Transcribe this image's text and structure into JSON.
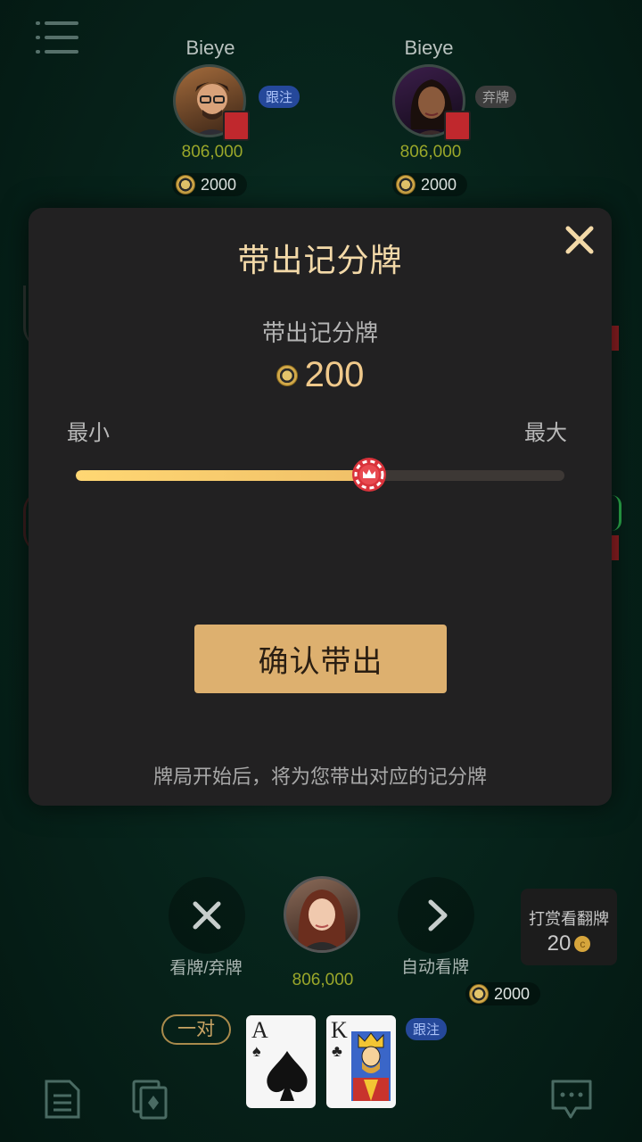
{
  "players": [
    {
      "name": "Bieye",
      "status": "跟注",
      "chips": "806,000",
      "bet": "2000"
    },
    {
      "name": "Bieye",
      "status": "弃牌",
      "chips": "806,000",
      "bet": "2000"
    }
  ],
  "modal": {
    "title": "带出记分牌",
    "subtitle": "带出记分牌",
    "amount": "200",
    "min_label": "最小",
    "max_label": "最大",
    "slider_value": 0.6,
    "confirm_label": "确认带出",
    "hint": "牌局开始后，将为您带出对应的记分牌"
  },
  "self": {
    "chips": "806,000",
    "bet": "2000",
    "hand_label": "一对",
    "status": "跟注",
    "cards": [
      {
        "rank": "A",
        "suit": "♠"
      },
      {
        "rank": "K",
        "suit": "♣"
      }
    ]
  },
  "actions": {
    "fold_label": "看牌/弃牌",
    "auto_label": "自动看牌"
  },
  "reward": {
    "label": "打赏看翻牌",
    "cost": "20"
  },
  "colors": {
    "accent_gold": "#ddb06f",
    "title_gold": "#f3d9a8",
    "chip_green": "#9aa72a",
    "call_blue": "#25489a"
  }
}
